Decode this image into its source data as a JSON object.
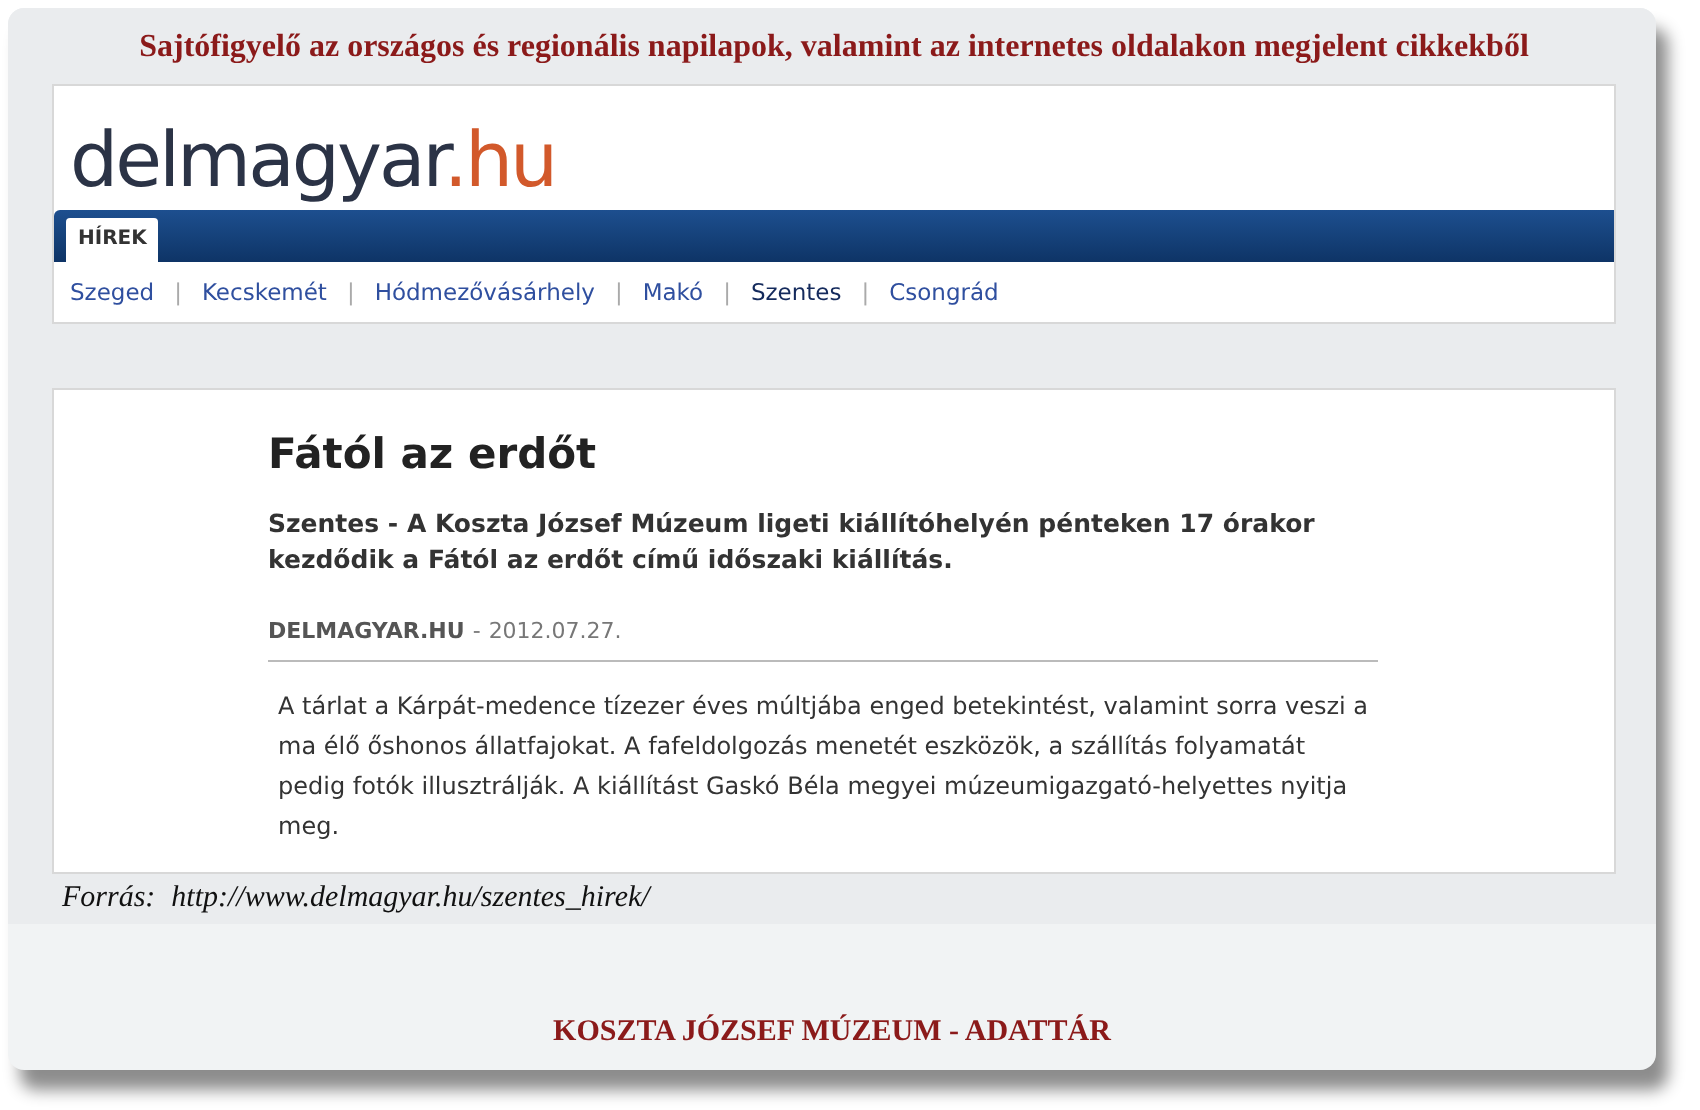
{
  "header": {
    "title": "Sajtófigyelő az országos és regionális napilapok, valamint az internetes oldalakon megjelent cikkekből"
  },
  "site": {
    "logo": {
      "name": "delmagyar",
      "tld": ".hu"
    },
    "tabs": [
      {
        "label": "HÍREK",
        "selected": true
      }
    ],
    "links": [
      {
        "label": "Szeged",
        "selected": false
      },
      {
        "label": "Kecskemét",
        "selected": false
      },
      {
        "label": "Hódmezővásárhely",
        "selected": false
      },
      {
        "label": "Makó",
        "selected": false
      },
      {
        "label": "Szentes",
        "selected": true
      },
      {
        "label": "Csongrád",
        "selected": false
      }
    ],
    "separator": "|"
  },
  "article": {
    "title": "Fától az erdőt",
    "lead": "Szentes - A Koszta József Múzeum ligeti kiállítóhelyén pénteken 17 órakor kezdődik a Fától az erdőt című időszaki kiállítás.",
    "source": "DELMAGYAR.HU",
    "separator": "-",
    "date": "2012.07.27.",
    "body": "A tárlat a Kárpát-medence tízezer éves múltjába enged betekintést, valamint sorra veszi a ma élő őshonos állatfajokat. A fafeldolgozás menetét eszközök, a szállítás folyamatát pedig fotók illusztrálják. A kiállítást Gaskó Béla megyei múzeumigazgató-helyettes nyitja meg."
  },
  "citation": {
    "label": "Forrás:",
    "url": "http://www.delmagyar.hu/szentes_hirek/"
  },
  "footer": {
    "text": "KOSZTA JÓZSEF MÚZEUM - ADATTÁR"
  }
}
